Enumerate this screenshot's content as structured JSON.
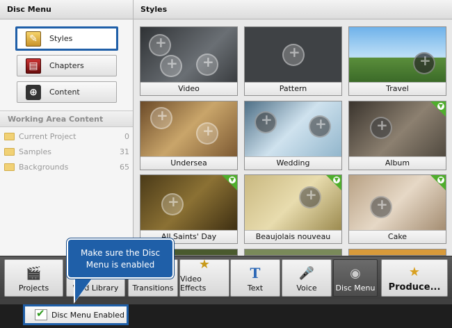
{
  "left_panel": {
    "title": "Disc Menu",
    "nav": [
      {
        "label": "Styles",
        "icon": "styles-icon",
        "active": true
      },
      {
        "label": "Chapters",
        "icon": "chapters-icon",
        "active": false
      },
      {
        "label": "Content",
        "icon": "content-icon",
        "active": false
      }
    ],
    "working_area": {
      "title": "Working Area Content",
      "items": [
        {
          "label": "Current Project",
          "count": "0"
        },
        {
          "label": "Samples",
          "count": "31"
        },
        {
          "label": "Backgrounds",
          "count": "65"
        }
      ]
    }
  },
  "styles_panel": {
    "title": "Styles",
    "tiles": [
      {
        "label": "Video",
        "download": false,
        "bg": "#555a5f"
      },
      {
        "label": "Pattern",
        "download": false,
        "bg": "#4a4d50"
      },
      {
        "label": "Travel",
        "download": false,
        "bg": "#7fb7e6"
      },
      {
        "label": "Undersea",
        "download": false,
        "bg": "#8a6a3f"
      },
      {
        "label": "Wedding",
        "download": false,
        "bg": "#7fa3b8"
      },
      {
        "label": "Album",
        "download": true,
        "bg": "#6a5f52"
      },
      {
        "label": "All Saints' Day",
        "download": true,
        "bg": "#6e5a2a"
      },
      {
        "label": "Beaujolais nouveau",
        "download": true,
        "bg": "#b5a05c"
      },
      {
        "label": "Cake",
        "download": true,
        "bg": "#cbb8a2"
      }
    ]
  },
  "toolbar": {
    "items": [
      {
        "label": "Projects",
        "icon": "clapperboard-icon"
      },
      {
        "label": "Wild Library",
        "icon": "library-icon"
      },
      {
        "label": "Transitions",
        "icon": "transitions-icon"
      },
      {
        "label": "Video Effects",
        "icon": "video-effects-icon"
      },
      {
        "label": "Text",
        "icon": "text-icon"
      },
      {
        "label": "Voice",
        "icon": "microphone-icon"
      },
      {
        "label": "Disc Menu",
        "icon": "disc-icon"
      },
      {
        "label": "Produce...",
        "icon": "produce-icon"
      }
    ]
  },
  "tooltip": {
    "text": "Make sure the Disc Menu is enabled"
  },
  "status": {
    "disc_menu_enabled_label": "Disc Menu Enabled"
  }
}
